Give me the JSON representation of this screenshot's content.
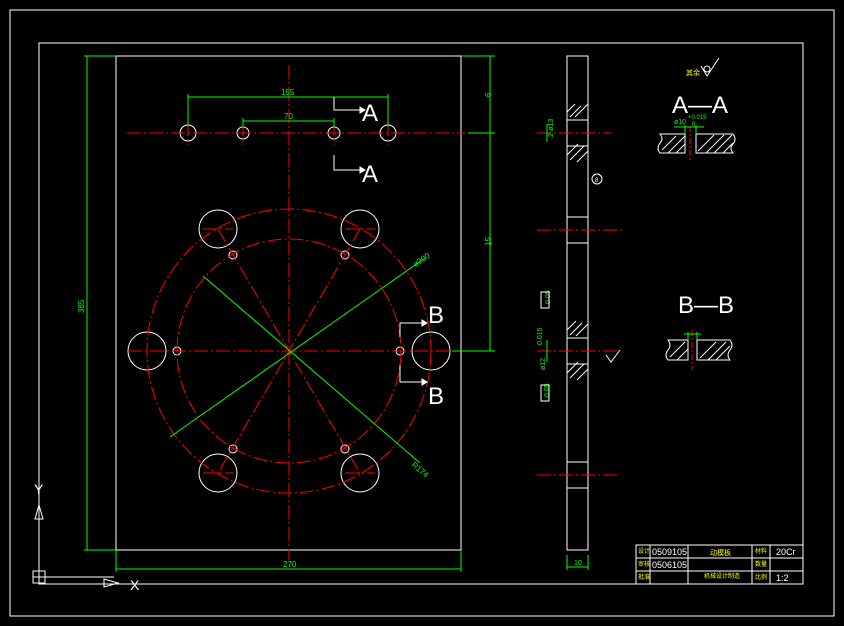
{
  "colors": {
    "background": "#000000",
    "outline": "#ffffff",
    "centerline": "#ff0000",
    "dimension": "#00ff00",
    "section_hatch": "#ffffff",
    "title_text": "#ffff00"
  },
  "dimensions": {
    "outer_span": "155",
    "inner_span": "70",
    "height": "385",
    "width": "270",
    "top_offset": "6",
    "side_offset": "15",
    "bolt_circle": "ø200",
    "pitch_circle": "R174"
  },
  "section_labels": {
    "a_upper": "A",
    "a_lower": "A",
    "b_upper": "B",
    "b_lower": "B"
  },
  "side_view": {
    "hole_note_top": "2-ø13",
    "hole_note_mid": "ø12",
    "tol_mid": "0.015",
    "tol_small_1": "0.05",
    "tol_small_2": "0.05",
    "note_bottom": "10",
    "circle_mark": "8"
  },
  "detail_views": {
    "roughness_note": "其余",
    "aa_title": "A—A",
    "aa_dim": "ø10",
    "aa_tol": "+0.015",
    "aa_tol_low": "0",
    "bb_title": "B—B"
  },
  "title_block": {
    "row1_label": "设计",
    "row1_name": "0509105",
    "row2_label": "审核",
    "row2_name": "0506105",
    "row3_label": "批准",
    "part_name": "动模板",
    "school": "机械设计制造",
    "material_label": "材料",
    "material": "20Cr",
    "qty_label": "数量",
    "scale_label": "比例",
    "scale": "1:2"
  },
  "ucs": {
    "y_label": "Y",
    "x_label": "X"
  }
}
